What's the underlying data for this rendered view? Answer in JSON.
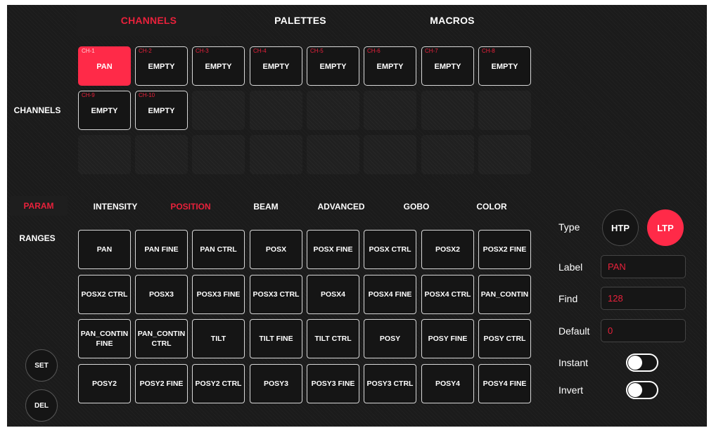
{
  "top_tabs": [
    {
      "label": "CHANNELS",
      "active": true
    },
    {
      "label": "PALETTES",
      "active": false
    },
    {
      "label": "MACROS",
      "active": false
    }
  ],
  "side": {
    "channels_label": "CHANNELS",
    "param_label": "PARAM",
    "ranges_label": "RANGES"
  },
  "channels": [
    {
      "id": "CH-1",
      "name": "PAN",
      "active": true
    },
    {
      "id": "CH-2",
      "name": "EMPTY"
    },
    {
      "id": "CH-3",
      "name": "EMPTY"
    },
    {
      "id": "CH-4",
      "name": "EMPTY"
    },
    {
      "id": "CH-5",
      "name": "EMPTY"
    },
    {
      "id": "CH-6",
      "name": "EMPTY"
    },
    {
      "id": "CH-7",
      "name": "EMPTY"
    },
    {
      "id": "CH-8",
      "name": "EMPTY"
    },
    {
      "id": "CH-9",
      "name": "EMPTY"
    },
    {
      "id": "CH-10",
      "name": "EMPTY"
    }
  ],
  "categories": [
    {
      "label": "INTENSITY",
      "active": false
    },
    {
      "label": "POSITION",
      "active": true
    },
    {
      "label": "BEAM",
      "active": false
    },
    {
      "label": "ADVANCED",
      "active": false
    },
    {
      "label": "GOBO",
      "active": false
    },
    {
      "label": "COLOR",
      "active": false
    }
  ],
  "params": [
    "PAN",
    "PAN FINE",
    "PAN CTRL",
    "POSX",
    "POSX FINE",
    "POSX CTRL",
    "POSX2",
    "POSX2 FINE",
    "POSX2 CTRL",
    "POSX3",
    "POSX3 FINE",
    "POSX3 CTRL",
    "POSX4",
    "POSX4 FINE",
    "POSX4 CTRL",
    "PAN_CONTIN",
    "PAN_CONTIN\nFINE",
    "PAN_CONTIN\nCTRL",
    "TILT",
    "TILT FINE",
    "TILT CTRL",
    "POSY",
    "POSY FINE",
    "POSY CTRL",
    "POSY2",
    "POSY2 FINE",
    "POSY2 CTRL",
    "POSY3",
    "POSY3 FINE",
    "POSY3 CTRL",
    "POSY4",
    "POSY4 FINE"
  ],
  "actions": {
    "set_label": "SET",
    "del_label": "DEL"
  },
  "panel": {
    "type_label": "Type",
    "htp_label": "HTP",
    "ltp_label": "LTP",
    "selected_type": "LTP",
    "label_label": "Label",
    "label_value": "PAN",
    "find_label": "Find",
    "find_value": "128",
    "default_label": "Default",
    "default_value": "0",
    "instant_label": "Instant",
    "instant_on": false,
    "invert_label": "Invert",
    "invert_on": false
  },
  "colors": {
    "accent": "#ff2a48",
    "background": "#1b1b1b"
  }
}
